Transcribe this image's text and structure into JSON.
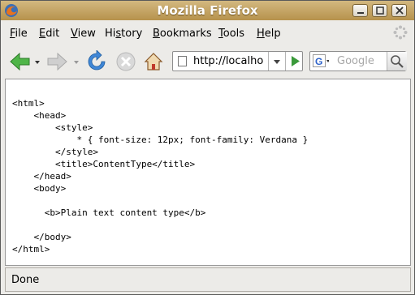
{
  "window": {
    "title": "Mozilla Firefox"
  },
  "menu": {
    "items": [
      {
        "accel": "F",
        "rest": "ile"
      },
      {
        "accel": "E",
        "rest": "dit"
      },
      {
        "accel": "V",
        "rest": "iew"
      },
      {
        "pre": "Hi",
        "accel": "s",
        "rest": "tory"
      },
      {
        "accel": "B",
        "rest": "ookmarks"
      },
      {
        "accel": "T",
        "rest": "ools"
      },
      {
        "accel": "H",
        "rest": "elp"
      }
    ]
  },
  "navigation": {
    "url": "http://localhost/",
    "search_placeholder": "Google"
  },
  "content": {
    "source_lines": [
      "<html>",
      "    <head>",
      "        <style>",
      "            * { font-size: 12px; font-family: Verdana }",
      "        </style>",
      "        <title>ContentType</title>",
      "    </head>",
      "    <body>",
      "",
      "      <b>Plain text content type</b>",
      "",
      "    </body>",
      "</html>"
    ]
  },
  "status": {
    "text": "Done"
  },
  "colors": {
    "titlebar": "#c4a466",
    "back_arrow": "#3aa83a",
    "reload": "#3a7fd0",
    "go": "#3a9a3a"
  },
  "icons": [
    "firefox-icon",
    "minimize-icon",
    "maximize-icon",
    "close-icon",
    "throbber-icon",
    "back-icon",
    "forward-icon",
    "reload-icon",
    "stop-icon",
    "home-icon",
    "google-icon",
    "magnifier-icon"
  ]
}
